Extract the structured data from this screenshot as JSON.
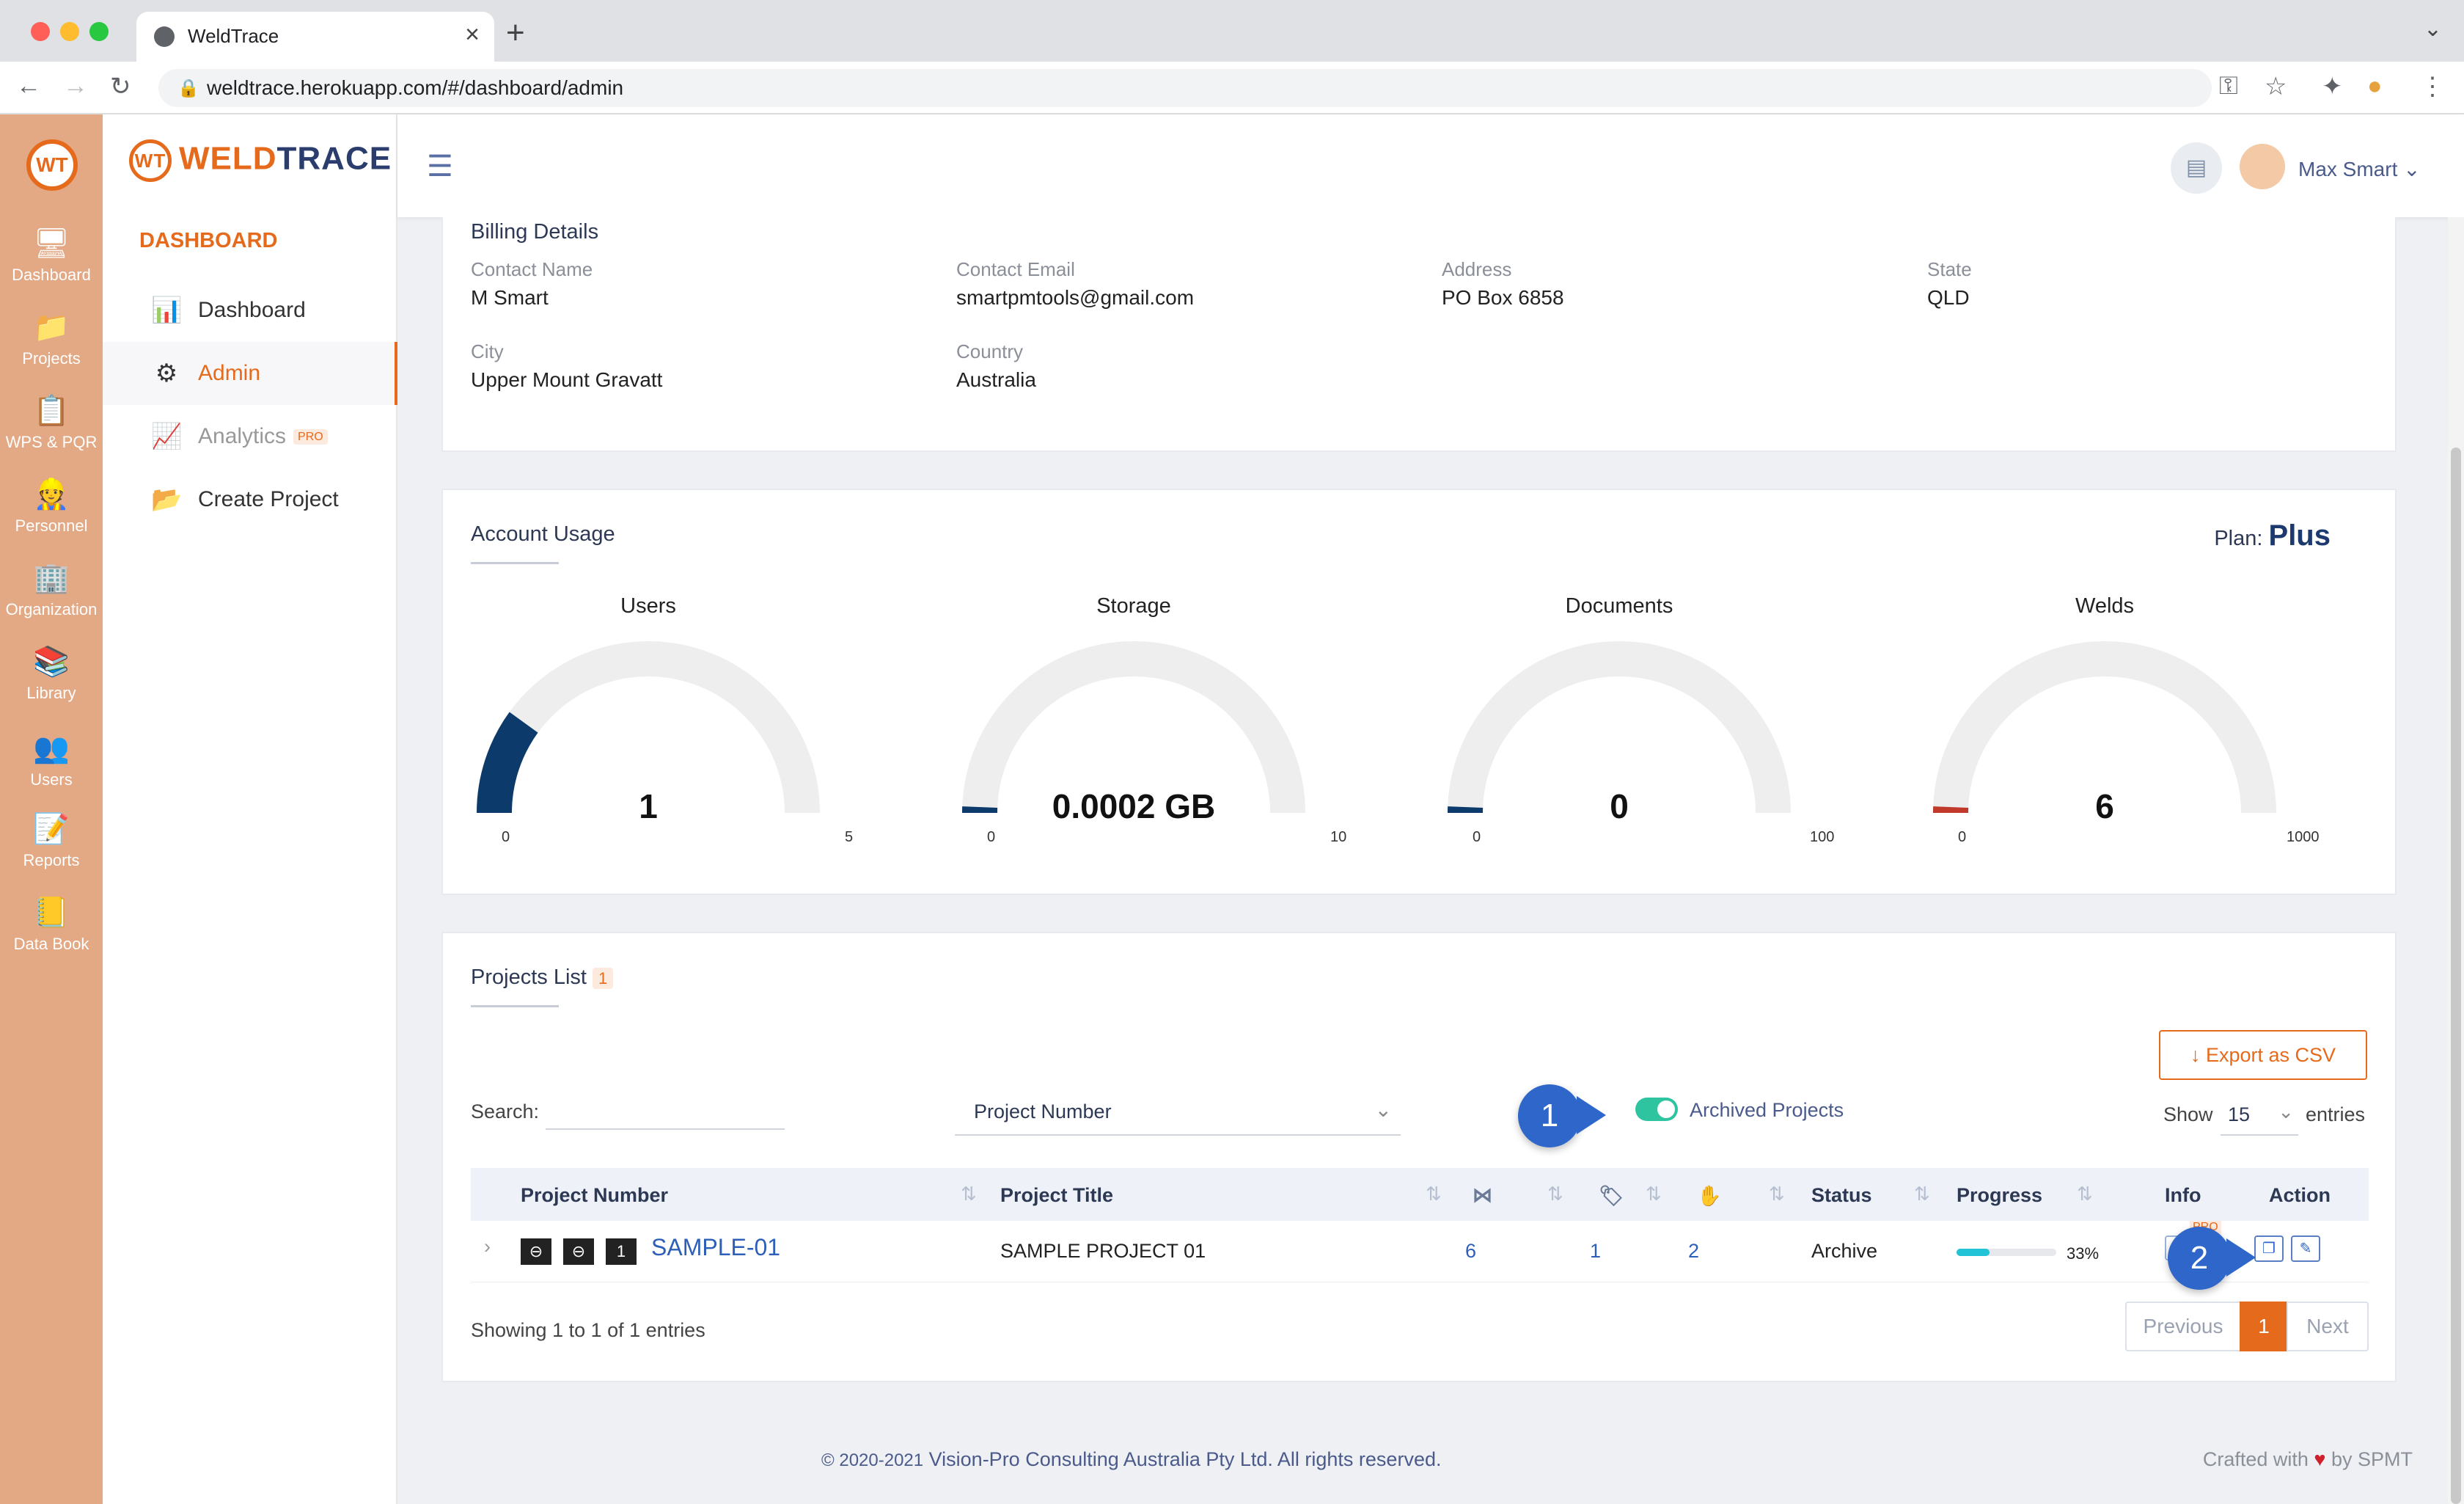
{
  "browser": {
    "tab_title": "WeldTrace",
    "url": "weldtrace.herokuapp.com/#/dashboard/admin"
  },
  "rail": {
    "items": [
      "Dashboard",
      "Projects",
      "WPS & PQR",
      "Personnel",
      "Organization",
      "Library",
      "Users",
      "Reports",
      "Data Book"
    ]
  },
  "sidebar": {
    "brand_weld": "WELD",
    "brand_trace": "TRACE",
    "brand_mark": "WT",
    "section_title": "DASHBOARD",
    "items": [
      {
        "label": "Dashboard"
      },
      {
        "label": "Admin"
      },
      {
        "label": "Analytics",
        "badge": "PRO"
      },
      {
        "label": "Create Project"
      }
    ]
  },
  "topbar": {
    "user_name": "Max Smart"
  },
  "billing": {
    "title": "Billing Details",
    "fields": [
      {
        "label": "Contact Name",
        "value": "M Smart"
      },
      {
        "label": "Contact Email",
        "value": "smartpmtools@gmail.com"
      },
      {
        "label": "Address",
        "value": "PO Box 6858"
      },
      {
        "label": "State",
        "value": "QLD"
      },
      {
        "label": "City",
        "value": "Upper Mount Gravatt"
      },
      {
        "label": "Country",
        "value": "Australia"
      }
    ]
  },
  "usage": {
    "title": "Account Usage",
    "plan_label": "Plan:",
    "plan_value": "Plus",
    "gauges": [
      {
        "title": "Users",
        "value": "1",
        "min": "0",
        "max": "5",
        "fraction": 0.2,
        "color": "#0c3a6b"
      },
      {
        "title": "Storage",
        "value": "0.0002 GB",
        "min": "0",
        "max": "10",
        "fraction": 0.0,
        "color": "#0c3a6b"
      },
      {
        "title": "Documents",
        "value": "0",
        "min": "0",
        "max": "100",
        "fraction": 0.0,
        "color": "#0c3a6b"
      },
      {
        "title": "Welds",
        "value": "6",
        "min": "0",
        "max": "1000",
        "fraction": 0.006,
        "color": "#c0392b"
      }
    ]
  },
  "projects": {
    "title": "Projects List",
    "count": "1",
    "export_label": "Export as CSV",
    "search_label": "Search:",
    "filter_value": "Project Number",
    "archived_label": "Archived Projects",
    "archived_on": true,
    "show_label": "Show",
    "show_value": "15",
    "entries_label": "entries",
    "columns": [
      "Project Number",
      "Project Title",
      "Status",
      "Progress",
      "Info",
      "Action"
    ],
    "rows": [
      {
        "tags": [
          "⊖",
          "⊖",
          "1"
        ],
        "number": "SAMPLE-01",
        "title": "SAMPLE PROJECT 01",
        "c1": "6",
        "c2": "1",
        "c3": "2",
        "status": "Archive",
        "progress": 0.33,
        "progress_label": "33%",
        "info_badge": "PRO"
      }
    ],
    "showing": "Showing 1 to 1 of 1 entries",
    "pager": {
      "prev": "Previous",
      "page": "1",
      "next": "Next"
    }
  },
  "annotations": {
    "step1": "1",
    "step2": "2"
  },
  "footer": {
    "copyright": "© 2020-2021",
    "company": "Vision-Pro Consulting Australia Pty Ltd. All rights reserved.",
    "crafted_pre": "Crafted with",
    "crafted_post": "by SPMT"
  },
  "colors": {
    "accent": "#e56a1b",
    "brand_blue": "#2b3d6d",
    "link": "#2e5fb8",
    "toggle": "#2ec4a0",
    "progress": "#22c3d6"
  }
}
